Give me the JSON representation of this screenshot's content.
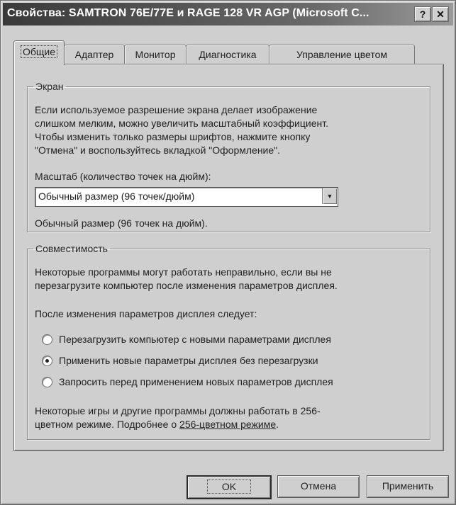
{
  "window": {
    "title": "Свойства: SAMTRON 76E/77E и RAGE 128 VR AGP (Microsoft C...",
    "help_button": "?",
    "close_button": "✕"
  },
  "tabs": [
    {
      "label": "Общие",
      "active": true
    },
    {
      "label": "Адаптер",
      "active": false
    },
    {
      "label": "Монитор",
      "active": false
    },
    {
      "label": "Диагностика",
      "active": false
    },
    {
      "label": "Управление цветом",
      "active": false
    }
  ],
  "screen_group": {
    "label": "Экран",
    "description_lines": [
      "Если используемое разрешение экрана делает изображение",
      "слишком мелким, можно увеличить масштабный коэффициент.",
      "Чтобы изменить только размеры шрифтов, нажмите кнопку",
      "\"Отмена\" и воспользуйтесь вкладкой \"Оформление\"."
    ],
    "scale_label": "Масштаб (количество точек на дюйм):",
    "scale_selected": "Обычный размер (96 точек/дюйм)",
    "scale_status": "Обычный размер (96 точек на дюйм)."
  },
  "compat_group": {
    "label": "Совместимость",
    "description_lines": [
      "Некоторые программы могут работать неправильно, если вы не",
      "перезагрузите компьютер после изменения параметров дисплея."
    ],
    "after_change_label": "После изменения параметров дисплея следует:",
    "options": [
      {
        "label": "Перезагрузить компьютер с новыми параметрами дисплея",
        "checked": false
      },
      {
        "label": "Применить новые параметры дисплея без перезагрузки",
        "checked": true
      },
      {
        "label": "Запросить перед применением новых параметров дисплея",
        "checked": false
      }
    ],
    "note_line1": "Некоторые игры и другие программы должны работать в 256-",
    "note_line2_prefix": "цветном режиме. Подробнее о ",
    "note_link": "256-цветном режиме",
    "note_suffix": "."
  },
  "buttons": {
    "ok": "OK",
    "cancel": "Отмена",
    "apply": "Применить"
  }
}
